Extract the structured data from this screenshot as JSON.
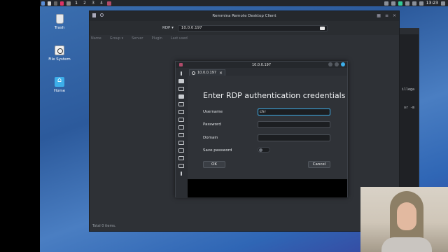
{
  "taskbar": {
    "workspaces": [
      "1",
      "2",
      "3",
      "4"
    ],
    "clock": "13:23"
  },
  "desktop": {
    "icons": [
      {
        "label": "Trash",
        "icon": "trash-icon"
      },
      {
        "label": "File System",
        "icon": "drive-icon"
      },
      {
        "label": "Home",
        "icon": "home-folder-icon"
      }
    ]
  },
  "main_window": {
    "title": "Remmina Remote Desktop Client",
    "protocol": "RDP ▾",
    "address": "10.0.0.197",
    "columns": [
      "Name",
      "Group ▾",
      "Server",
      "Plugin",
      "Last used"
    ],
    "status": "Total 0 items."
  },
  "terminal_fragments": [
    "illega",
    "or -m"
  ],
  "dialog": {
    "window_title": "10.0.0.197",
    "tab_label": "10.0.0.197",
    "tab_close": "×",
    "heading": "Enter RDP authentication credentials",
    "fields": {
      "username_label": "Username",
      "username_value": "chr",
      "password_label": "Password",
      "password_value": "",
      "domain_label": "Domain",
      "domain_value": "",
      "save_password_label": "Save password"
    },
    "ok_label": "OK",
    "cancel_label": "Cancel"
  },
  "colors": {
    "accent": "#3daee9",
    "dialog_bg": "#2f3237",
    "desktop_bg": "#3b6fb0"
  }
}
